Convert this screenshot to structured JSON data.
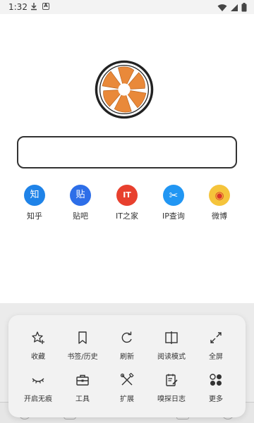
{
  "status_bar": {
    "time": "1:32",
    "app_icon_letter": "A"
  },
  "search": {
    "value": "",
    "placeholder": ""
  },
  "shortcuts": [
    {
      "name": "zhihu",
      "icon_text": "知",
      "label": "知乎",
      "color": "#1f83e8"
    },
    {
      "name": "tieba",
      "icon_text": "贴",
      "label": "贴吧",
      "color": "#2d6ee8"
    },
    {
      "name": "ithome",
      "icon_text": "IT",
      "label": "IT之家",
      "color": "#e8402e"
    },
    {
      "name": "ip-lookup",
      "icon_text": "✂",
      "label": "IP查询",
      "color": "#2196f3"
    },
    {
      "name": "weibo",
      "icon_text": "◉",
      "label": "微博",
      "color": "#f5c43b"
    }
  ],
  "menu": {
    "row1": [
      {
        "name": "favorite",
        "label": "收藏",
        "icon": "star-plus-icon"
      },
      {
        "name": "bookmarks-history",
        "label": "书签/历史",
        "icon": "bookmark-icon"
      },
      {
        "name": "refresh",
        "label": "刷新",
        "icon": "refresh-icon"
      },
      {
        "name": "reading-mode",
        "label": "阅读模式",
        "icon": "book-open-icon"
      },
      {
        "name": "fullscreen",
        "label": "全屏",
        "icon": "fullscreen-icon"
      }
    ],
    "row2": [
      {
        "name": "incognito",
        "label": "开启无痕",
        "icon": "closed-eye-icon"
      },
      {
        "name": "tools",
        "label": "工具",
        "icon": "toolbox-icon"
      },
      {
        "name": "extensions",
        "label": "扩展",
        "icon": "tools-cross-icon"
      },
      {
        "name": "sniff-log",
        "label": "嗅探日志",
        "icon": "log-edit-icon"
      },
      {
        "name": "more",
        "label": "更多",
        "icon": "more-dots-icon"
      }
    ]
  }
}
